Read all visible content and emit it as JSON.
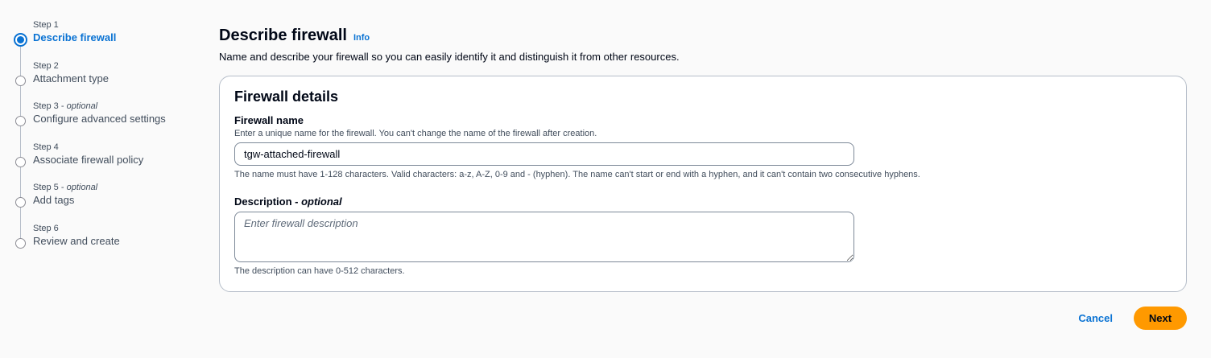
{
  "steps": [
    {
      "number": "Step 1",
      "optional": "",
      "label": "Describe firewall",
      "active": true
    },
    {
      "number": "Step 2",
      "optional": "",
      "label": "Attachment type",
      "active": false
    },
    {
      "number": "Step 3",
      "optional": "optional",
      "label": "Configure advanced settings",
      "active": false
    },
    {
      "number": "Step 4",
      "optional": "",
      "label": "Associate firewall policy",
      "active": false
    },
    {
      "number": "Step 5",
      "optional": "optional",
      "label": "Add tags",
      "active": false
    },
    {
      "number": "Step 6",
      "optional": "",
      "label": "Review and create",
      "active": false
    }
  ],
  "page": {
    "title": "Describe firewall",
    "info_link": "Info",
    "subtitle": "Name and describe your firewall so you can easily identify it and distinguish it from other resources."
  },
  "panel": {
    "title": "Firewall details",
    "name_field": {
      "label": "Firewall name",
      "description": "Enter a unique name for the firewall. You can't change the name of the firewall after creation.",
      "value": "tgw-attached-firewall",
      "constraint": "The name must have 1-128 characters. Valid characters: a-z, A-Z, 0-9 and - (hyphen). The name can't start or end with a hyphen, and it can't contain two consecutive hyphens."
    },
    "description_field": {
      "label": "Description",
      "optional": "optional",
      "placeholder": "Enter firewall description",
      "value": "",
      "constraint": "The description can have 0-512 characters."
    }
  },
  "actions": {
    "cancel_label": "Cancel",
    "next_label": "Next"
  },
  "colors": {
    "accent": "#0972d3",
    "primary_button": "#ff9900"
  }
}
